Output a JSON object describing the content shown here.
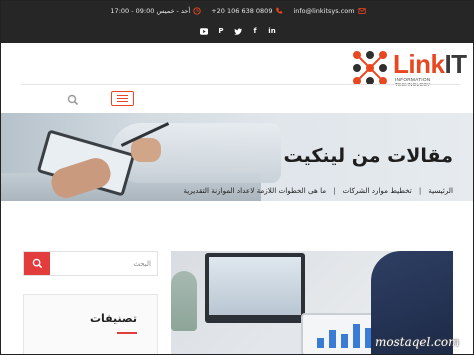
{
  "topbar": {
    "hours": "أحد - خميس 09:00 - 17:00",
    "phone": "+20 106 638 0809",
    "email": "info@linkitsys.com",
    "social": [
      "linkedin",
      "facebook",
      "twitter",
      "pinterest",
      "youtube"
    ]
  },
  "header": {
    "logo_main_1": "Link",
    "logo_main_2": "IT",
    "logo_sub": "INFORMATION TECHNOLOGY"
  },
  "hero": {
    "title": "مقالات من لينكيت",
    "breadcrumb": [
      "الرئيسية",
      "تخطيط موارد الشركات",
      "ما هى الخطوات اللازمة لاعداد الموازنة التقديرية"
    ],
    "separator": "|"
  },
  "sidebar": {
    "search_placeholder": "البحث",
    "categories_title": "تصنيفات"
  },
  "watermark": "mostaqel.com",
  "colors": {
    "accent": "#e8471f",
    "red_button": "#e23c3c",
    "topbar_bg": "#262626"
  }
}
